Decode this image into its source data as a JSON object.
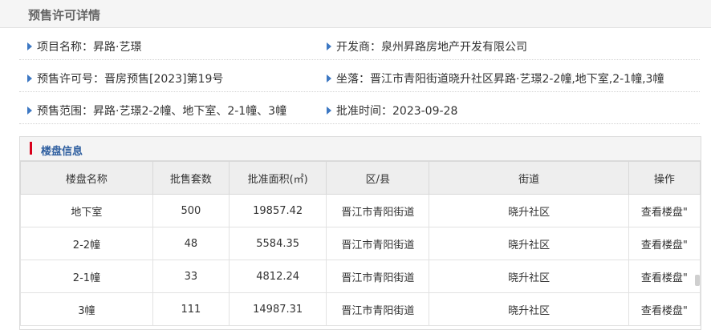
{
  "page": {
    "title": "预售许可详情"
  },
  "info": {
    "rows": [
      [
        {
          "label": "项目名称：",
          "value": "昇路·艺璟"
        },
        {
          "label": "开发商：",
          "value": "泉州昇路房地产开发有限公司"
        }
      ],
      [
        {
          "label": "预售许可号：",
          "value": "晋房预售[2023]第19号"
        },
        {
          "label": "坐落：",
          "value": "晋江市青阳街道晓升社区昇路·艺璟2-2幢,地下室,2-1幢,3幢"
        }
      ],
      [
        {
          "label": "预售范围：",
          "value": "昇路·艺璟2-2幢、地下室、2-1幢、3幢"
        },
        {
          "label": "批准时间：",
          "value": "2023-09-28"
        }
      ]
    ]
  },
  "buildings": {
    "section_title": "楼盘信息",
    "columns": [
      "楼盘名称",
      "批售套数",
      "批准面积(㎡)",
      "区/县",
      "街道",
      "操作"
    ],
    "rows": [
      {
        "name": "地下室",
        "units": "500",
        "area": "19857.42",
        "district": "晋江市青阳街道",
        "street": "晓升社区",
        "action": "查看楼盘\""
      },
      {
        "name": "2-2幢",
        "units": "48",
        "area": "5584.35",
        "district": "晋江市青阳街道",
        "street": "晓升社区",
        "action": "查看楼盘\""
      },
      {
        "name": "2-1幢",
        "units": "33",
        "area": "4812.24",
        "district": "晋江市青阳街道",
        "street": "晓升社区",
        "action": "查看楼盘\""
      },
      {
        "name": "3幢",
        "units": "111",
        "area": "14987.31",
        "district": "晋江市青阳街道",
        "street": "晓升社区",
        "action": "查看楼盘\""
      }
    ]
  },
  "colors": {
    "accent": "#d9001b",
    "link": "#2e5e9f",
    "triangle": "#3d78c3"
  }
}
